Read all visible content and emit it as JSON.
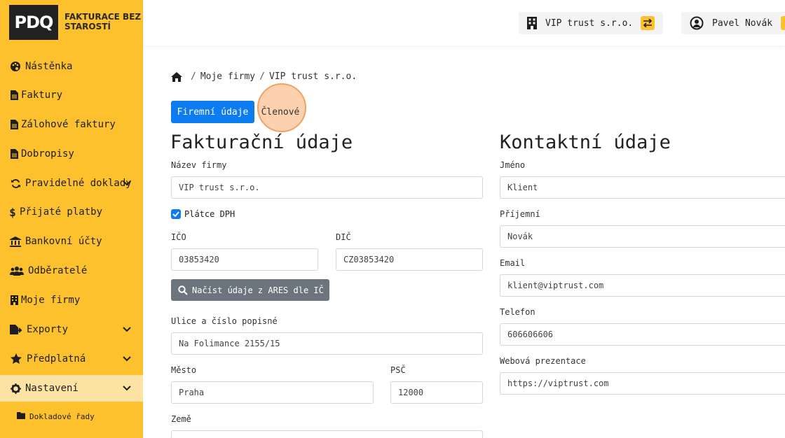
{
  "brand": {
    "logo": "PDQ",
    "tagline": "FAKTURACE BEZ STAROSTÍ"
  },
  "sidebar": {
    "items": [
      {
        "label": "Nástěnka",
        "icon": "palette-icon"
      },
      {
        "label": "Faktury",
        "icon": "file-icon"
      },
      {
        "label": "Zálohové faktury",
        "icon": "file-icon"
      },
      {
        "label": "Dobropisy",
        "icon": "file-icon"
      },
      {
        "label": "Pravidelné doklady",
        "icon": "sync-icon"
      },
      {
        "label": "Přijaté platby",
        "icon": "dollar-icon"
      },
      {
        "label": "Bankovní účty",
        "icon": "bank-icon"
      },
      {
        "label": "Odběratelé",
        "icon": "users-icon"
      },
      {
        "label": "Moje firmy",
        "icon": "building-icon"
      },
      {
        "label": "Exporty",
        "icon": "export-icon"
      },
      {
        "label": "Předplatná",
        "icon": "star-icon"
      },
      {
        "label": "Nastavení",
        "icon": "gear-icon"
      }
    ],
    "sub_items": [
      {
        "label": "Dokladové řady",
        "icon": "folder-icon"
      }
    ]
  },
  "header": {
    "company": "VIP trust s.r.o.",
    "user": "Pavel Novák"
  },
  "breadcrumb": {
    "items": [
      "Moje firmy",
      "VIP trust s.r.o."
    ],
    "separator": "/"
  },
  "tabs": {
    "active": "Firemní údaje",
    "other": "Členové"
  },
  "billing": {
    "title": "Fakturační údaje",
    "company_name_label": "Název firmy",
    "company_name": "VIP trust s.r.o.",
    "vat_payer_label": "Plátce DPH",
    "vat_payer_checked": true,
    "ico_label": "IČO",
    "ico": "03853420",
    "dic_label": "DIČ",
    "dic": "CZ03853420",
    "ares_button": "Načíst údaje z ARES dle IČ",
    "street_label": "Ulice a číslo popisné",
    "street": "Na Folimance 2155/15",
    "city_label": "Město",
    "city": "Praha",
    "zip_label": "PSČ",
    "zip": "12000",
    "country_label": "Země"
  },
  "contact": {
    "title": "Kontaktní údaje",
    "firstname_label": "Jméno",
    "firstname": "Klient",
    "lastname_label": "Příjemní",
    "lastname": "Novák",
    "email_label": "Email",
    "email": "klient@viptrust.com",
    "phone_label": "Telefon",
    "phone": "606606606",
    "web_label": "Webová prezentace",
    "web": "https://viptrust.com"
  },
  "colors": {
    "sidebar": "#fec12e",
    "active_nav": "#fde3a3",
    "primary": "#0d7cf0",
    "secondary_button": "#6c757d"
  }
}
